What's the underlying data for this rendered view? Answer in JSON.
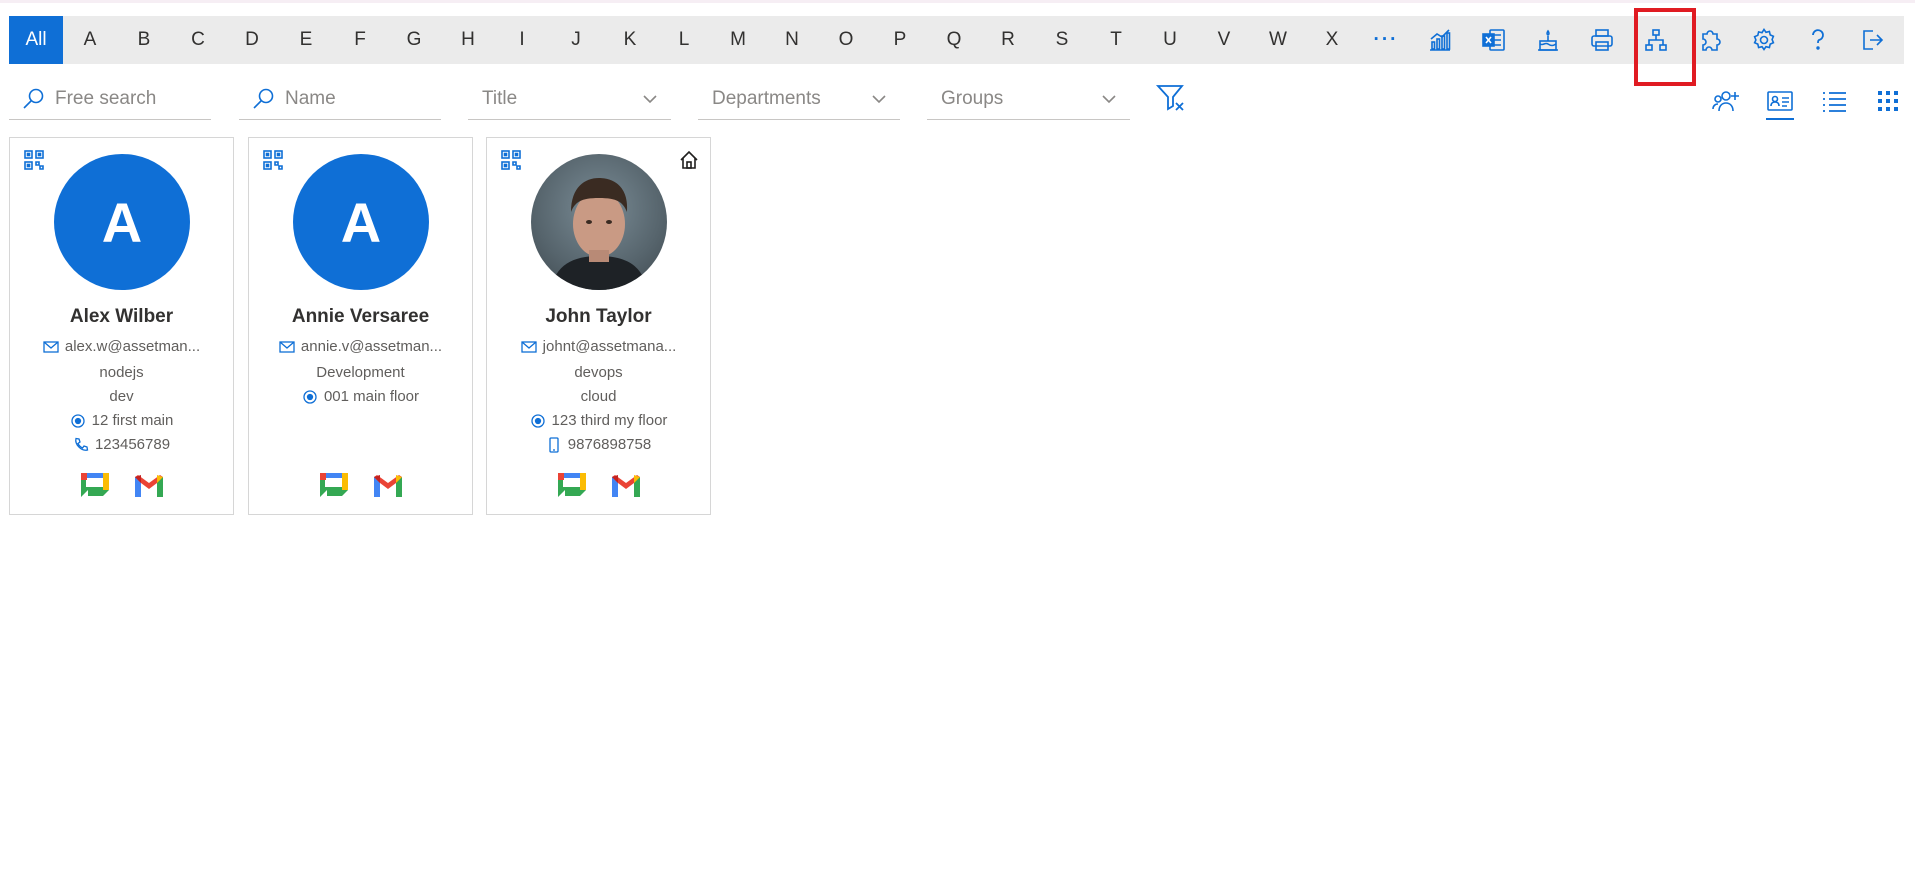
{
  "alphabet": {
    "letters": [
      "All",
      "A",
      "B",
      "C",
      "D",
      "E",
      "F",
      "G",
      "H",
      "I",
      "J",
      "K",
      "L",
      "M",
      "N",
      "O",
      "P",
      "Q",
      "R",
      "S",
      "T",
      "U",
      "V",
      "W",
      "X"
    ],
    "more_label": "···"
  },
  "toolbar": {
    "icons": [
      "chart-icon",
      "excel-icon",
      "birthday-cake-icon",
      "print-icon",
      "org-chart-icon",
      "puzzle-icon",
      "settings-icon",
      "help-icon",
      "sign-out-icon"
    ],
    "highlighted": "org-chart-icon",
    "accent": "#0f6fd6",
    "highlight_color": "#e01b22"
  },
  "filters": {
    "free_search_placeholder": "Free search",
    "name_placeholder": "Name",
    "title_placeholder": "Title",
    "departments_placeholder": "Departments",
    "groups_placeholder": "Groups"
  },
  "view_icons": [
    "people-add-icon",
    "card-view-icon",
    "list-view-icon",
    "grid-view-icon"
  ],
  "active_view": "card-view-icon",
  "cards": [
    {
      "initial": "A",
      "name": "Alex Wilber",
      "email": "alex.w@assetman...",
      "line1": "nodejs",
      "line2": "dev",
      "location": "12 first main",
      "phone": "123456789",
      "phone_type": "phone-icon"
    },
    {
      "initial": "A",
      "name": "Annie Versaree",
      "email": "annie.v@assetman...",
      "line1": "Development",
      "location": "001 main floor"
    },
    {
      "name": "John Taylor",
      "email": "johnt@assetmana...",
      "line1": "devops",
      "line2": "cloud",
      "location": "123 third my floor",
      "phone": "9876898758",
      "phone_type": "mobile-icon"
    }
  ]
}
